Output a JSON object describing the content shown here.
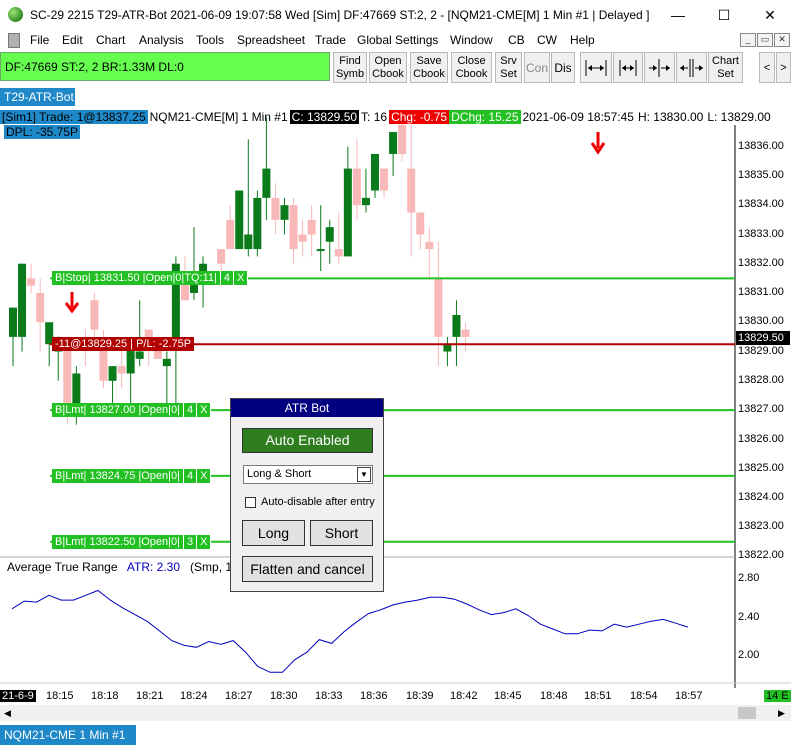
{
  "window": {
    "title": "SC-29 2215 T29-ATR-Bot  2021-06-09  19:07:58 Wed [Sim]  DF:47669  ST:2, 2 - [NQM21-CME[M]  1 Min   #1 | Delayed ]",
    "minimize": "—",
    "maximize": "☐",
    "close": "✕"
  },
  "menu": [
    "File",
    "Edit",
    "Chart",
    "Analysis",
    "Tools",
    "Spreadsheet",
    "Trade",
    "Global Settings",
    "Window",
    "CB",
    "CW",
    "Help"
  ],
  "status_box": "DF:47669  ST:2, 2  BR:1.33M  DL:0",
  "toolbar": {
    "find_symb": [
      "Find",
      "Symb"
    ],
    "open_cbook": [
      "Open",
      "Cbook"
    ],
    "save_cbook": [
      "Save",
      "Cbook"
    ],
    "close_cbook": [
      "Close",
      "Cbook"
    ],
    "srv_set": [
      "Srv",
      "Set"
    ],
    "con": "Con",
    "dis": "Dis",
    "chart_set": [
      "Chart",
      "Set"
    ],
    "icons": [
      "expand-bars-icon",
      "compress-bars-icon",
      "scroll-left-icon",
      "scroll-right-icon"
    ],
    "arrow_left": "<",
    "arrow_right": ">"
  },
  "chart_tab": "T29-ATR-Bot",
  "info_bar": {
    "sim": "[Sim1]",
    "trade": "Trade: 1@13837.25",
    "symbol": "NQM21-CME[M]  1 Min   #1",
    "close": "C: 13829.50",
    "ticks": "T: 16",
    "chg": "Chg: -0.75",
    "dchg": "DChg: 15.25",
    "datetime": "2021-06-09  18:57:45",
    "high": "H: 13830.00",
    "low": "L: 13829.00",
    "dpl": "DPL: -35.75P"
  },
  "colors": {
    "up_candle": "#0a7a1a",
    "down_candle": "#f8b8b8",
    "order_line": "#22c022",
    "position_line": "#b00000",
    "atr_line": "#0000c0",
    "chart_tab": "#1e88c8",
    "panel_header": "#000080",
    "auto_enabled": "#2e7d1e"
  },
  "orders": [
    {
      "label_parts": [
        "B|Stop| 13831.50 |Open|0|TQ:11|",
        "4",
        "X"
      ],
      "price": 13831.5
    },
    {
      "label_parts": [
        "B|Lmt| 13827.00 |Open|0|",
        "4",
        "X"
      ],
      "price": 13827.0
    },
    {
      "label_parts": [
        "B|Lmt| 13824.75 |Open|0|",
        "4",
        "X"
      ],
      "price": 13824.75
    },
    {
      "label_parts": [
        "B|Lmt| 13822.50 |Open|0|",
        "3",
        "X"
      ],
      "price": 13822.5
    }
  ],
  "position": {
    "label": "-11@13829.25 | P/L: -2.75P",
    "price": 13829.25
  },
  "current_price_label": "13829.50",
  "price_axis": [
    "13836.00",
    "13835.00",
    "13834.00",
    "13833.00",
    "13832.00",
    "13831.00",
    "13830.00",
    "13829.00",
    "13828.00",
    "13827.00",
    "13826.00",
    "13825.00",
    "13824.00",
    "13823.00",
    "13822.00"
  ],
  "atr_axis": [
    "2.80",
    "2.40",
    "2.00"
  ],
  "time_axis": [
    "21-6-9",
    "18:15",
    "18:18",
    "18:21",
    "18:24",
    "18:27",
    "18:30",
    "18:33",
    "18:36",
    "18:39",
    "18:42",
    "18:45",
    "18:48",
    "18:51",
    "18:54",
    "18:57"
  ],
  "time_badge_right": "14 E",
  "atr_study": {
    "name": "Average True Range",
    "value": "ATR: 2.30",
    "params": "(Smp, 14)"
  },
  "atr_bot_panel": {
    "title": "ATR Bot",
    "auto_button": "Auto Enabled",
    "mode_select": "Long & Short",
    "auto_disable_label": "Auto-disable after entry",
    "auto_disable_checked": false,
    "long_button": "Long",
    "short_button": "Short",
    "flatten_button": "Flatten and cancel"
  },
  "bottom_tab": "NQM21-CME  1 Min   #1",
  "chart_data": {
    "type": "candlestick",
    "price_range": [
      13821.5,
      13836.5
    ],
    "candles": [
      {
        "o": 13829.5,
        "h": 13830.5,
        "l": 13828.5,
        "c": 13830.5
      },
      {
        "o": 13829.5,
        "h": 13832.0,
        "l": 13829.0,
        "c": 13832.0
      },
      {
        "o": 13831.5,
        "h": 13832.0,
        "l": 13831.0,
        "c": 13831.25
      },
      {
        "o": 13831.0,
        "h": 13831.5,
        "l": 13829.0,
        "c": 13830.0
      },
      {
        "o": 13829.25,
        "h": 13829.5,
        "l": 13828.5,
        "c": 13830.0
      },
      {
        "o": 13829.0,
        "h": 13829.5,
        "l": 13828.0,
        "c": 13829.5
      },
      {
        "o": 13829.5,
        "h": 13829.5,
        "l": 13826.5,
        "c": 13827.25
      },
      {
        "o": 13827.0,
        "h": 13828.5,
        "l": 13826.5,
        "c": 13828.25
      },
      {
        "o": 13829.5,
        "h": 13829.75,
        "l": 13828.5,
        "c": 13829.25
      },
      {
        "o": 13830.75,
        "h": 13831.0,
        "l": 13829.5,
        "c": 13829.75
      },
      {
        "o": 13829.25,
        "h": 13829.75,
        "l": 13827.75,
        "c": 13828.0
      },
      {
        "o": 13828.0,
        "h": 13828.5,
        "l": 13827.0,
        "c": 13828.5
      },
      {
        "o": 13828.5,
        "h": 13829.5,
        "l": 13827.75,
        "c": 13828.25
      },
      {
        "o": 13828.25,
        "h": 13829.0,
        "l": 13827.0,
        "c": 13829.25
      },
      {
        "o": 13828.75,
        "h": 13830.75,
        "l": 13828.5,
        "c": 13829.0
      },
      {
        "o": 13829.75,
        "h": 13829.5,
        "l": 13828.5,
        "c": 13829.5
      },
      {
        "o": 13829.25,
        "h": 13829.25,
        "l": 13828.75,
        "c": 13828.75
      },
      {
        "o": 13828.5,
        "h": 13829.0,
        "l": 13827.0,
        "c": 13828.75
      },
      {
        "o": 13829.25,
        "h": 13832.25,
        "l": 13827.0,
        "c": 13832.0
      },
      {
        "o": 13831.75,
        "h": 13832.25,
        "l": 13830.75,
        "c": 13830.75
      },
      {
        "o": 13831.0,
        "h": 13833.25,
        "l": 13830.75,
        "c": 13831.75
      },
      {
        "o": 13831.75,
        "h": 13832.25,
        "l": 13830.5,
        "c": 13832.0
      },
      {
        "o": 13831.75,
        "h": 13831.75,
        "l": 13831.5,
        "c": 13831.75
      },
      {
        "o": 13832.5,
        "h": 13832.5,
        "l": 13831.25,
        "c": 13832.0
      },
      {
        "o": 13833.5,
        "h": 13834.0,
        "l": 13832.5,
        "c": 13832.5
      },
      {
        "o": 13832.5,
        "h": 13834.5,
        "l": 13832.5,
        "c": 13834.5
      },
      {
        "o": 13832.5,
        "h": 13836.25,
        "l": 13832.25,
        "c": 13833.0
      },
      {
        "o": 13832.5,
        "h": 13834.5,
        "l": 13832.25,
        "c": 13834.25
      },
      {
        "o": 13834.25,
        "h": 13837.0,
        "l": 13833.5,
        "c": 13835.25
      },
      {
        "o": 13834.25,
        "h": 13834.75,
        "l": 13833.0,
        "c": 13833.5
      },
      {
        "o": 13833.5,
        "h": 13834.25,
        "l": 13833.0,
        "c": 13834.0
      },
      {
        "o": 13834.0,
        "h": 13834.25,
        "l": 13832.0,
        "c": 13832.5
      },
      {
        "o": 13833.0,
        "h": 13833.5,
        "l": 13832.25,
        "c": 13832.75
      },
      {
        "o": 13833.5,
        "h": 13834.0,
        "l": 13832.25,
        "c": 13833.0
      },
      {
        "o": 13832.5,
        "h": 13834.0,
        "l": 13831.75,
        "c": 13832.5
      },
      {
        "o": 13832.75,
        "h": 13833.5,
        "l": 13832.0,
        "c": 13833.25
      },
      {
        "o": 13832.5,
        "h": 13833.75,
        "l": 13832.0,
        "c": 13832.25
      },
      {
        "o": 13832.25,
        "h": 13836.0,
        "l": 13832.25,
        "c": 13835.25
      },
      {
        "o": 13835.25,
        "h": 13836.25,
        "l": 13833.5,
        "c": 13834.0
      },
      {
        "o": 13834.0,
        "h": 13835.25,
        "l": 13833.75,
        "c": 13834.25
      },
      {
        "o": 13834.5,
        "h": 13835.75,
        "l": 13834.25,
        "c": 13835.75
      },
      {
        "o": 13835.25,
        "h": 13835.25,
        "l": 13834.25,
        "c": 13834.5
      },
      {
        "o": 13835.75,
        "h": 13836.5,
        "l": 13835.0,
        "c": 13836.5
      },
      {
        "o": 13836.75,
        "h": 13837.25,
        "l": 13835.5,
        "c": 13835.75
      },
      {
        "o": 13835.25,
        "h": 13836.75,
        "l": 13832.25,
        "c": 13833.75
      },
      {
        "o": 13833.75,
        "h": 13833.75,
        "l": 13832.5,
        "c": 13833.0
      },
      {
        "o": 13832.75,
        "h": 13833.25,
        "l": 13831.5,
        "c": 13832.5
      },
      {
        "o": 13831.5,
        "h": 13832.75,
        "l": 13828.5,
        "c": 13829.5
      },
      {
        "o": 13829.0,
        "h": 13829.5,
        "l": 13828.5,
        "c": 13829.25
      },
      {
        "o": 13829.5,
        "h": 13830.75,
        "l": 13828.5,
        "c": 13830.25
      },
      {
        "o": 13829.75,
        "h": 13830.0,
        "l": 13829.0,
        "c": 13829.5
      }
    ],
    "atr_range": [
      1.6,
      3.0
    ],
    "atr_values": [
      2.48,
      2.56,
      2.55,
      2.62,
      2.57,
      2.57,
      2.62,
      2.67,
      2.57,
      2.49,
      2.42,
      2.35,
      2.25,
      2.15,
      2.1,
      2.08,
      2.14,
      2.11,
      2.15,
      2.03,
      1.88,
      1.82,
      1.82,
      1.95,
      2.03,
      2.16,
      2.12,
      2.24,
      2.34,
      2.43,
      2.47,
      2.52,
      2.55,
      2.57,
      2.6,
      2.6,
      2.58,
      2.53,
      2.47,
      2.42,
      2.44,
      2.48,
      2.41,
      2.32,
      2.27,
      2.22,
      2.22,
      2.26,
      2.25,
      2.32,
      2.29,
      2.32,
      2.35,
      2.37,
      2.33,
      2.29
    ]
  }
}
